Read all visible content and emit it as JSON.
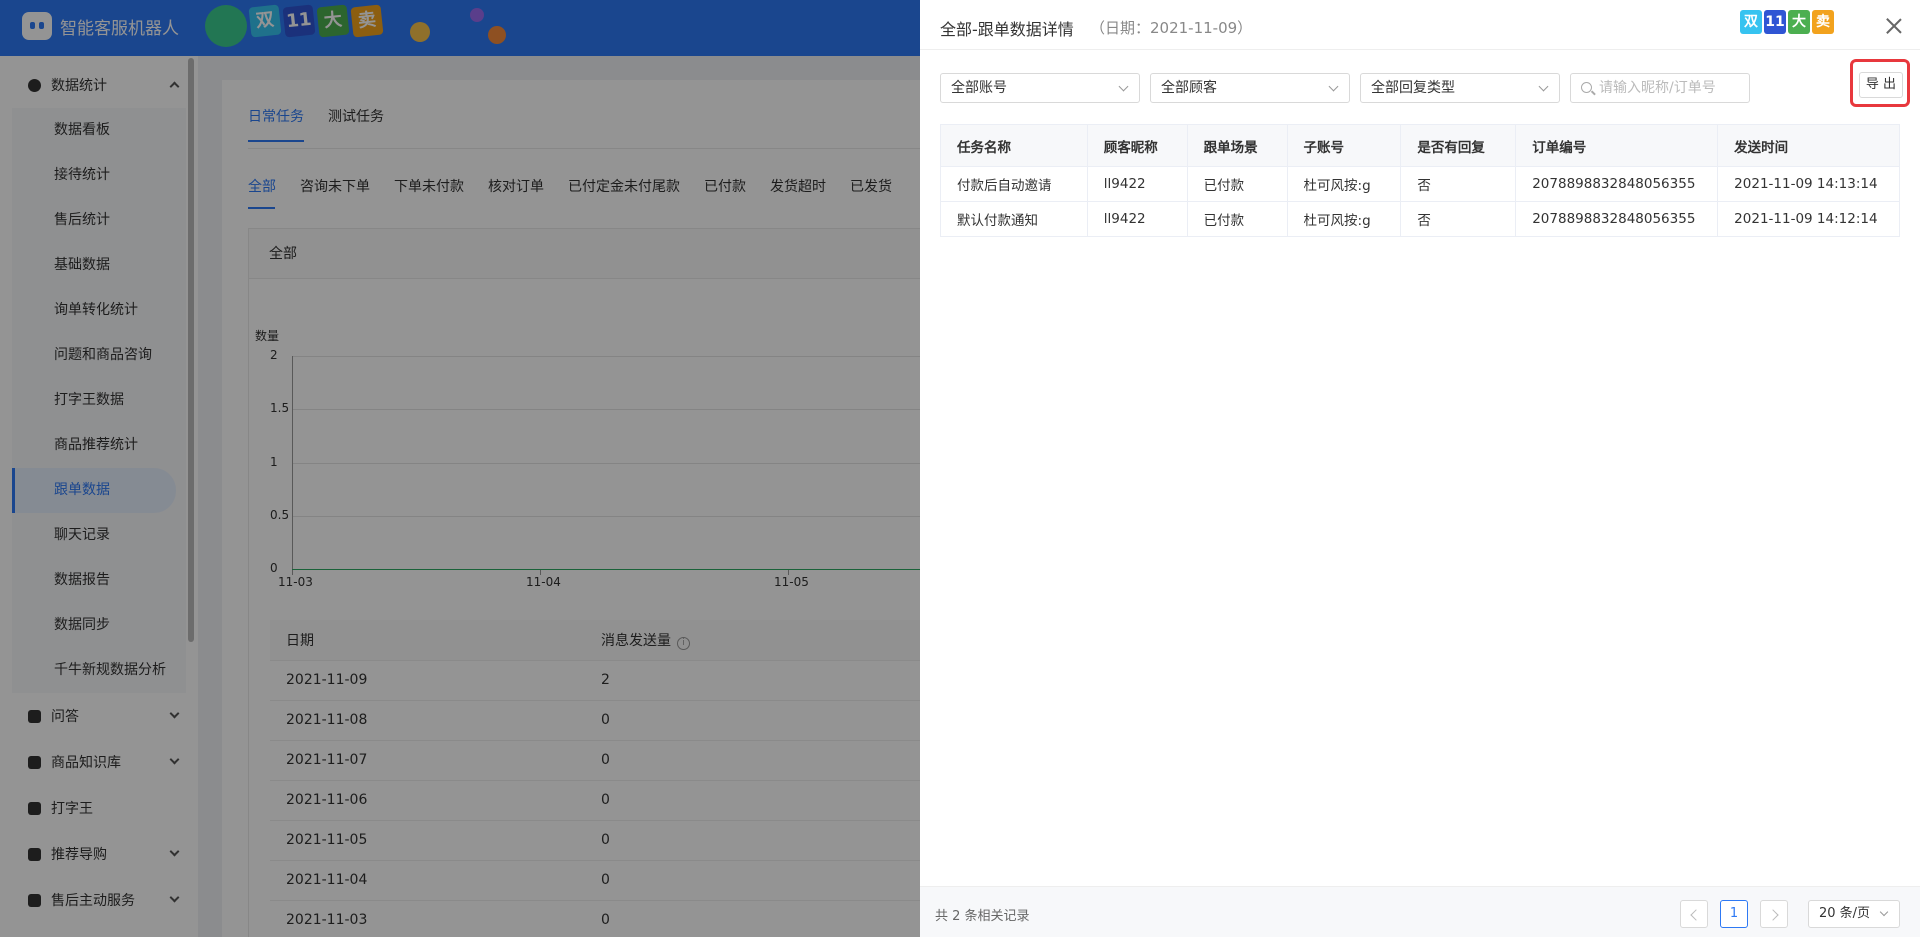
{
  "app": {
    "title": "智能客服机器人"
  },
  "sidebar": {
    "group_stats": "数据统计",
    "stat_items": [
      "数据看板",
      "接待统计",
      "售后统计",
      "基础数据",
      "询单转化统计",
      "问题和商品咨询",
      "打字王数据",
      "商品推荐统计",
      "跟单数据",
      "聊天记录",
      "数据报告",
      "数据同步",
      "千牛新规数据分析"
    ],
    "active_item": "跟单数据",
    "groups": [
      "问答",
      "商品知识库",
      "打字王",
      "推荐导购",
      "售后主动服务"
    ]
  },
  "main": {
    "tabs": [
      "日常任务",
      "测试任务"
    ],
    "filter_tabs": [
      "全部",
      "咨询未下单",
      "下单未付款",
      "核对订单",
      "已付定金未付尾款",
      "已付款",
      "发货超时",
      "已发货"
    ],
    "card_title": "全部",
    "chart_data": {
      "type": "line",
      "ylabel": "数量",
      "ylim": [
        0,
        2
      ],
      "yticks": [
        "2",
        "1.5",
        "1",
        "0.5",
        "0"
      ],
      "x": [
        "11-03",
        "11-04",
        "11-05"
      ],
      "series": [
        {
          "values": [
            0,
            0,
            0
          ]
        }
      ]
    },
    "table": {
      "headers": [
        "日期",
        "消息发送量"
      ],
      "rows": [
        [
          "2021-11-09",
          "2"
        ],
        [
          "2021-11-08",
          "0"
        ],
        [
          "2021-11-07",
          "0"
        ],
        [
          "2021-11-06",
          "0"
        ],
        [
          "2021-11-05",
          "0"
        ],
        [
          "2021-11-04",
          "0"
        ],
        [
          "2021-11-03",
          "0"
        ]
      ]
    }
  },
  "drawer": {
    "title": "全部-跟单数据详情",
    "date": "（日期：2021-11-09）",
    "promo": [
      "双",
      "11",
      "大",
      "卖"
    ],
    "filters": {
      "account": "全部账号",
      "customer": "全部顾客",
      "reply_type": "全部回复类型"
    },
    "search": {
      "placeholder": "请输入昵称/订单号"
    },
    "export_label": "导 出",
    "table": {
      "headers": [
        "任务名称",
        "顾客昵称",
        "跟单场景",
        "子账号",
        "是否有回复",
        "订单编号",
        "发送时间"
      ],
      "rows": [
        [
          "付款后自动邀请",
          "ll9422",
          "已付款",
          "杜可风按:g",
          "否",
          "2078898832848056355",
          "2021-11-09 14:13:14"
        ],
        [
          "默认付款通知",
          "ll9422",
          "已付款",
          "杜可风按:g",
          "否",
          "2078898832848056355",
          "2021-11-09 14:12:14"
        ]
      ]
    },
    "footer": {
      "total": "共 2 条相关记录",
      "page": "1",
      "page_size": "20 条/页"
    }
  },
  "colors": {
    "primary": "#2e79f4",
    "highlight": "#e8383d"
  }
}
